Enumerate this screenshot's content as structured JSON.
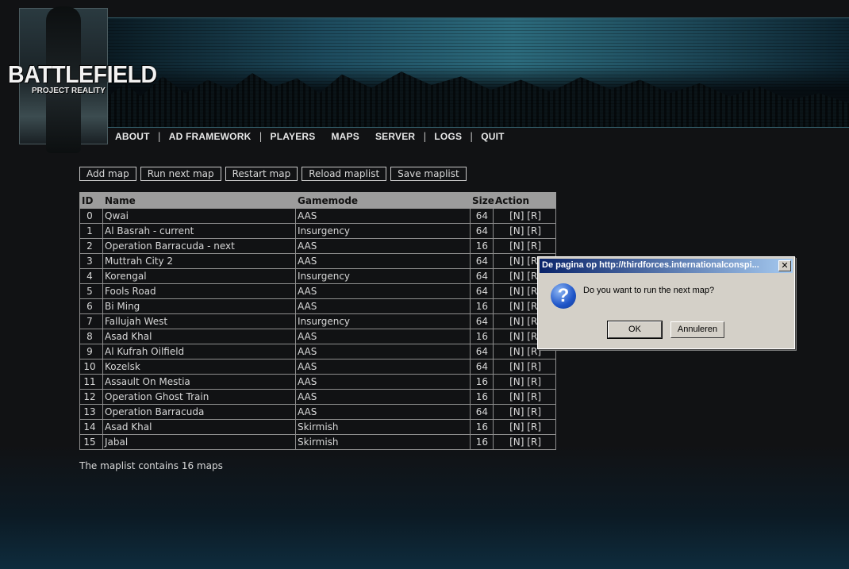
{
  "header": {
    "logo_title": "BATTLEFIELD",
    "logo_subtitle": "PROJECT REALITY"
  },
  "nav": {
    "items": [
      "ABOUT",
      "AD FRAMEWORK",
      "PLAYERS",
      "MAPS",
      "SERVER",
      "LOGS",
      "QUIT"
    ],
    "separator": "|"
  },
  "toolbar": {
    "add_map": "Add map",
    "run_next_map": "Run next map",
    "restart_map": "Restart map",
    "reload_maplist": "Reload maplist",
    "save_maplist": "Save maplist"
  },
  "table": {
    "headers": {
      "id": "ID",
      "name": "Name",
      "gamemode": "Gamemode",
      "size": "Size",
      "action": "Action"
    },
    "action_n": "[N]",
    "action_r": "[R]",
    "rows": [
      {
        "id": "0",
        "name": "Qwai",
        "gamemode": "AAS",
        "size": "64"
      },
      {
        "id": "1",
        "name": "Al Basrah - current",
        "gamemode": "Insurgency",
        "size": "64"
      },
      {
        "id": "2",
        "name": "Operation Barracuda - next",
        "gamemode": "AAS",
        "size": "16"
      },
      {
        "id": "3",
        "name": "Muttrah City 2",
        "gamemode": "AAS",
        "size": "64"
      },
      {
        "id": "4",
        "name": "Korengal",
        "gamemode": "Insurgency",
        "size": "64"
      },
      {
        "id": "5",
        "name": "Fools Road",
        "gamemode": "AAS",
        "size": "64"
      },
      {
        "id": "6",
        "name": "Bi Ming",
        "gamemode": "AAS",
        "size": "16"
      },
      {
        "id": "7",
        "name": "Fallujah West",
        "gamemode": "Insurgency",
        "size": "64"
      },
      {
        "id": "8",
        "name": "Asad Khal",
        "gamemode": "AAS",
        "size": "16"
      },
      {
        "id": "9",
        "name": "Al Kufrah Oilfield",
        "gamemode": "AAS",
        "size": "64"
      },
      {
        "id": "10",
        "name": "Kozelsk",
        "gamemode": "AAS",
        "size": "64"
      },
      {
        "id": "11",
        "name": "Assault On Mestia",
        "gamemode": "AAS",
        "size": "16"
      },
      {
        "id": "12",
        "name": "Operation Ghost Train",
        "gamemode": "AAS",
        "size": "16"
      },
      {
        "id": "13",
        "name": "Operation Barracuda",
        "gamemode": "AAS",
        "size": "64"
      },
      {
        "id": "14",
        "name": "Asad Khal",
        "gamemode": "Skirmish",
        "size": "16"
      },
      {
        "id": "15",
        "name": "Jabal",
        "gamemode": "Skirmish",
        "size": "16"
      }
    ]
  },
  "summary": "The maplist contains 16 maps",
  "dialog": {
    "title": "De pagina op http://thirdforces.internationalconspi...",
    "close_glyph": "✕",
    "icon": "question-icon",
    "icon_glyph": "?",
    "message": "Do you want to run the next map?",
    "ok_label": "OK",
    "cancel_label": "Annuleren"
  }
}
